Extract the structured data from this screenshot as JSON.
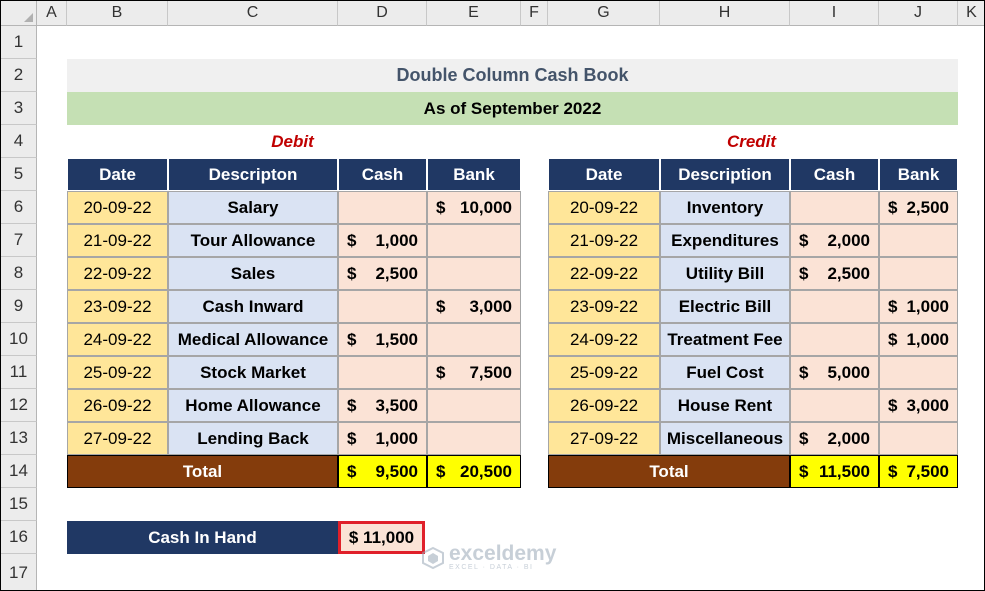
{
  "columns": [
    "A",
    "B",
    "C",
    "D",
    "E",
    "F",
    "G",
    "H",
    "I",
    "J",
    "K"
  ],
  "rows": [
    "1",
    "2",
    "3",
    "4",
    "5",
    "6",
    "7",
    "8",
    "9",
    "10",
    "11",
    "12",
    "13",
    "14",
    "15",
    "16",
    "17"
  ],
  "title": "Double Column Cash Book",
  "subtitle": "As of September 2022",
  "debit": {
    "label": "Debit",
    "headers": [
      "Date",
      "Descripton",
      "Cash",
      "Bank"
    ],
    "rows": [
      {
        "date": "20-09-22",
        "desc": "Salary",
        "cash": "",
        "bank": "10,000"
      },
      {
        "date": "21-09-22",
        "desc": "Tour Allowance",
        "cash": "1,000",
        "bank": ""
      },
      {
        "date": "22-09-22",
        "desc": "Sales",
        "cash": "2,500",
        "bank": ""
      },
      {
        "date": "23-09-22",
        "desc": "Cash Inward",
        "cash": "",
        "bank": "3,000"
      },
      {
        "date": "24-09-22",
        "desc": "Medical Allowance",
        "cash": "1,500",
        "bank": ""
      },
      {
        "date": "25-09-22",
        "desc": "Stock Market",
        "cash": "",
        "bank": "7,500"
      },
      {
        "date": "26-09-22",
        "desc": "Home Allowance",
        "cash": "3,500",
        "bank": ""
      },
      {
        "date": "27-09-22",
        "desc": "Lending Back",
        "cash": "1,000",
        "bank": ""
      }
    ],
    "total_label": "Total",
    "total_cash": "9,500",
    "total_bank": "20,500"
  },
  "credit": {
    "label": "Credit",
    "headers": [
      "Date",
      "Description",
      "Cash",
      "Bank"
    ],
    "rows": [
      {
        "date": "20-09-22",
        "desc": "Inventory",
        "cash": "",
        "bank": "2,500"
      },
      {
        "date": "21-09-22",
        "desc": "Expenditures",
        "cash": "2,000",
        "bank": ""
      },
      {
        "date": "22-09-22",
        "desc": "Utility Bill",
        "cash": "2,500",
        "bank": ""
      },
      {
        "date": "23-09-22",
        "desc": "Electric Bill",
        "cash": "",
        "bank": "1,000"
      },
      {
        "date": "24-09-22",
        "desc": "Treatment Fee",
        "cash": "",
        "bank": "1,000"
      },
      {
        "date": "25-09-22",
        "desc": "Fuel Cost",
        "cash": "5,000",
        "bank": ""
      },
      {
        "date": "26-09-22",
        "desc": "House Rent",
        "cash": "",
        "bank": "3,000"
      },
      {
        "date": "27-09-22",
        "desc": "Miscellaneous",
        "cash": "2,000",
        "bank": ""
      }
    ],
    "total_label": "Total",
    "total_cash": "11,500",
    "total_bank": "7,500"
  },
  "currency": "$",
  "cash_in_hand": {
    "label": "Cash In Hand",
    "value": "$ 11,000"
  },
  "watermark": {
    "name": "exceldemy",
    "tagline": "EXCEL · DATA · BI"
  }
}
